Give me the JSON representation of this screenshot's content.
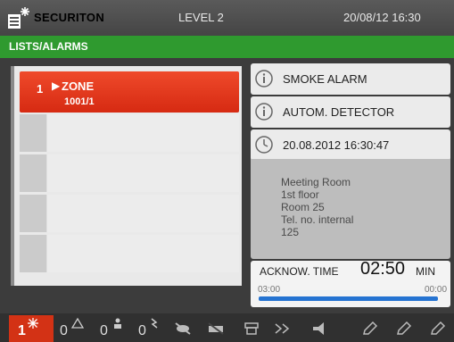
{
  "header": {
    "brand": "SECURITON",
    "level": "LEVEL 2",
    "datetime": "20/08/12 16:30"
  },
  "breadcrumb": {
    "prefix": "LISTS/",
    "current": "ALARMS"
  },
  "alarm_list": {
    "selected": {
      "index": "1",
      "title": "ZONE",
      "subtitle": "1001/1"
    },
    "empty_rows": 4
  },
  "info": {
    "alarm_type": "SMOKE ALARM",
    "detector_type": "AUTOM. DETECTOR",
    "timestamp": "20.08.2012 16:30:47",
    "details": [
      "Meeting Room",
      "1st floor",
      "Room 25",
      "Tel. no. internal",
      "125"
    ]
  },
  "acknowledge": {
    "label": "ACKNOW. TIME",
    "time": "02:50",
    "unit": "MIN",
    "range_start": "03:00",
    "range_end": "00:00",
    "progress": 0.94
  },
  "statusbar": {
    "fire_count": "1",
    "counts": [
      "0",
      "0",
      "0"
    ],
    "colors": {
      "fire": "#d33215",
      "accent": "#2f9a2f",
      "progress": "#2573d1"
    }
  }
}
